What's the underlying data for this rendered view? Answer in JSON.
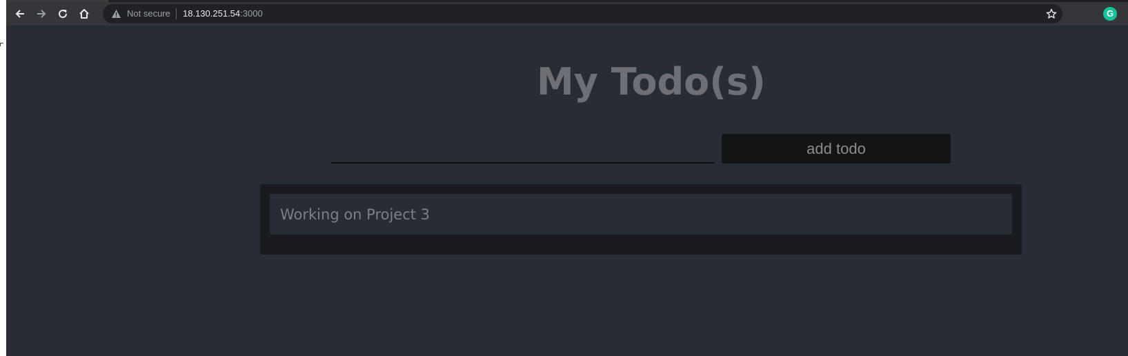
{
  "browser": {
    "security_label": "Not secure",
    "url_host": "18.130.251.54",
    "url_port": ":3000",
    "extension_letter": "G",
    "icons": {
      "back": "arrow-left-icon",
      "forward": "arrow-right-icon",
      "reload": "reload-icon",
      "home": "home-icon",
      "warning": "warning-triangle-icon",
      "bookmark": "star-icon",
      "extension": "grammarly-icon"
    }
  },
  "app": {
    "title": "My Todo(s)",
    "input": {
      "value": "",
      "placeholder": ""
    },
    "add_button_label": "add todo",
    "todos": [
      {
        "text": "Working on Project 3"
      }
    ]
  },
  "colors": {
    "page_background": "#282c34",
    "list_background": "#191b1f",
    "button_background": "#131416",
    "title_text": "#6e6f75",
    "grammarly_green": "#15c39a"
  }
}
